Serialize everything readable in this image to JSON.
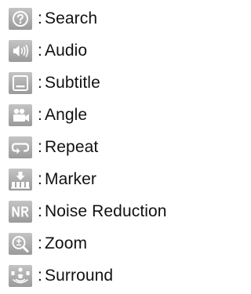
{
  "legend": {
    "separator": ":",
    "items": [
      {
        "icon": "search-icon",
        "label": "Search"
      },
      {
        "icon": "audio-icon",
        "label": "Audio"
      },
      {
        "icon": "subtitle-icon",
        "label": "Subtitle"
      },
      {
        "icon": "angle-icon",
        "label": "Angle"
      },
      {
        "icon": "repeat-icon",
        "label": "Repeat"
      },
      {
        "icon": "marker-icon",
        "label": "Marker"
      },
      {
        "icon": "noise-reduction-icon",
        "label": "Noise Reduction"
      },
      {
        "icon": "zoom-icon",
        "label": "Zoom"
      },
      {
        "icon": "surround-icon",
        "label": "Surround"
      }
    ],
    "colors": {
      "icon_background": "#a9a9a9",
      "icon_glyph": "#ffffff"
    }
  }
}
